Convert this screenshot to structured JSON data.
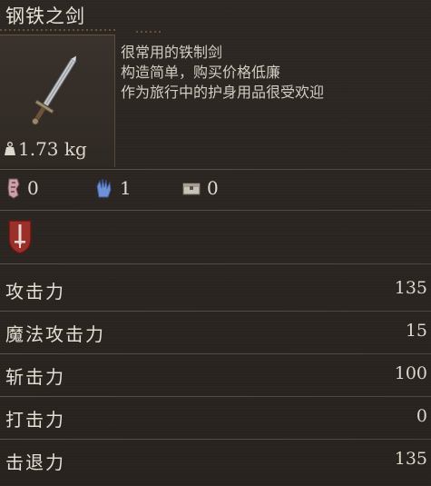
{
  "item": {
    "name": "钢铁之剑",
    "weight": "1.73 kg",
    "description": [
      "很常用的铁制剑",
      "构造简单，购买价格低廉",
      "作为旅行中的护身用品很受欢迎"
    ],
    "icon": "steel-sword-icon"
  },
  "requirements": [
    {
      "icon": "strength-requirement-icon",
      "value": "0"
    },
    {
      "icon": "magic-requirement-icon",
      "value": "1"
    },
    {
      "icon": "chest-requirement-icon",
      "value": "0"
    }
  ],
  "emblem_icon": "sword-shield-emblem-icon",
  "stats": [
    {
      "label": "攻击力",
      "value": "135"
    },
    {
      "label": "魔法攻击力",
      "value": "15"
    },
    {
      "label": "斩击力",
      "value": "100"
    },
    {
      "label": "打击力",
      "value": "0"
    },
    {
      "label": "击退力",
      "value": "135"
    }
  ],
  "colors": {
    "background": "#2b2521",
    "text": "#d9d3c9",
    "ornament": "#96784a",
    "strength_icon": "#c9a0a6",
    "magic_icon": "#6f8fd6",
    "emblem": "#9b2f2a"
  }
}
